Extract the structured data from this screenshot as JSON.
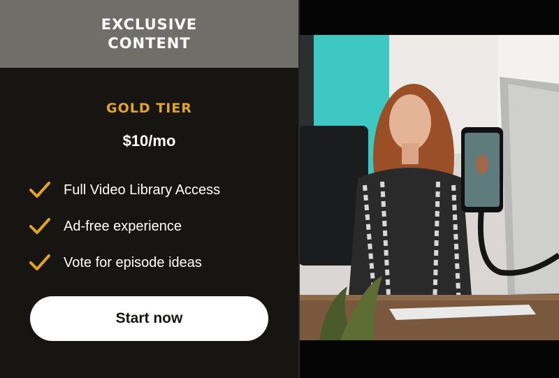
{
  "header": {
    "title": "EXCLUSIVE CONTENT"
  },
  "tier": {
    "name": "GOLD TIER",
    "price": "$10/mo"
  },
  "features": [
    {
      "label": "Full Video Library Access",
      "icon": "check-icon"
    },
    {
      "label": "Ad-free experience",
      "icon": "check-icon"
    },
    {
      "label": "Vote for episode ideas",
      "icon": "check-icon"
    }
  ],
  "cta": {
    "label": "Start now"
  },
  "colors": {
    "header_bg": "#6f6e69",
    "card_bg": "#161512",
    "accent_gold": "#e3a521",
    "button_bg": "#ffffff",
    "wall_teal": "#3ec8c4"
  }
}
